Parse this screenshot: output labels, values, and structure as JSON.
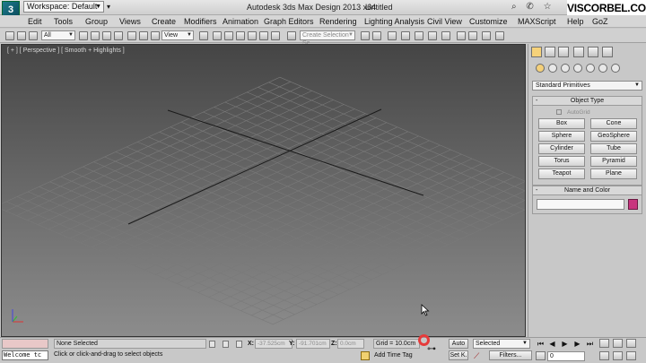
{
  "titlebar": {
    "workspace_label": "Workspace: Default",
    "app_title": "Autodesk 3ds Max Design 2013 x64",
    "file_name": "Untitled",
    "brand_overlay": "VISCORBEL.COM"
  },
  "menu": {
    "items": [
      "Edit",
      "Tools",
      "Group",
      "Views",
      "Create",
      "Modifiers",
      "Animation",
      "Graph Editors",
      "Rendering",
      "Lighting Analysis",
      "Civil View",
      "Customize",
      "MAXScript",
      "Help",
      "GoZ"
    ]
  },
  "toolbar": {
    "filter_select": "All",
    "ref_coord_select": "View",
    "selection_set_placeholder": "Create Selection Se"
  },
  "viewport": {
    "label": "[ + ] [ Perspective ] [ Smooth + Highlights ]"
  },
  "command_panel": {
    "category": "Standard Primitives",
    "object_type_title": "Object Type",
    "autogrid_label": "AutoGrid",
    "primitives": [
      "Box",
      "Cone",
      "Sphere",
      "GeoSphere",
      "Cylinder",
      "Tube",
      "Torus",
      "Pyramid",
      "Teapot",
      "Plane"
    ],
    "name_color_title": "Name and Color",
    "object_color": "#c8357e"
  },
  "status": {
    "maxscript_text": "Welcome tc",
    "selection_status": "None Selected",
    "prompt": "Click or click-and-drag to select objects",
    "x_label": "X:",
    "x_value": "-37.525cm",
    "y_label": "Y:",
    "y_value": "-91.701cm",
    "z_label": "Z:",
    "z_value": "0.0cm",
    "grid_readout": "Grid = 10.0cm",
    "add_time_tag": "Add Time Tag",
    "auto_key": "Auto",
    "set_key": "Set K.",
    "key_mode_select": "Selected",
    "filters": "Filters...",
    "current_frame": "0"
  }
}
